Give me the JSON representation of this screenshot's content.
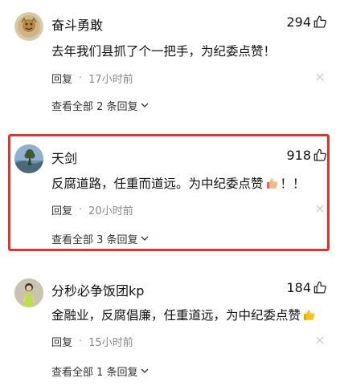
{
  "comments": [
    {
      "username": "奋斗勇敢",
      "likes": "294",
      "text": "去年我们县抓了个一把手，为纪委点赞！",
      "text_after_emoji": "",
      "reply_label": "回复",
      "separator": "·",
      "time": "17小时前",
      "view_replies": "查看全部 2 条回复"
    },
    {
      "username": "天剑",
      "likes": "918",
      "text": "反腐道路，任重而道远。为中纪委点赞",
      "text_after_emoji": "！！",
      "reply_label": "回复",
      "separator": "·",
      "time": "20小时前",
      "view_replies": "查看全部 3 条回复"
    },
    {
      "username": "分秒必争饭团kp",
      "likes": "184",
      "text": "金融业，反腐倡廉，任重道远，为中纪委点赞",
      "text_after_emoji": "",
      "reply_label": "回复",
      "separator": "·",
      "time": "15小时前",
      "view_replies": "查看全部 1 条回复"
    }
  ],
  "icons": {
    "like": "thumbs-up-outline-icon",
    "close": "close-icon",
    "expand": "chevron-down-icon",
    "emoji_thumb": "thumbs-up-emoji-icon"
  },
  "colors": {
    "highlight_border": "#e0322f",
    "text_primary": "#111111",
    "text_secondary": "#888888"
  }
}
